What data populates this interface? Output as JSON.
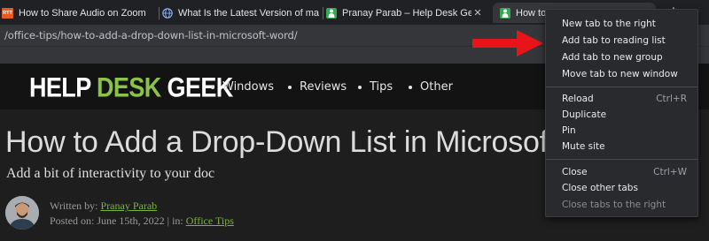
{
  "tabs": [
    {
      "title": "How to Share Audio on Zoom",
      "favicon": "rtt-favicon",
      "favicon_text": "RTT",
      "favicon_color": "#e85a1e",
      "active": false
    },
    {
      "title": "What Is the Latest Version of ma",
      "favicon": "globe-favicon",
      "favicon_color": "#1a73e8",
      "active": false
    },
    {
      "title": "Pranay Parab – Help Desk Geek",
      "favicon": "hdg-favicon",
      "favicon_color": "#34a853",
      "active": false
    },
    {
      "title": "How to Add a Drop-Down List in",
      "favicon": "hdg-favicon",
      "favicon_color": "#34a853",
      "active": true
    }
  ],
  "new_tab_symbol": "+",
  "address_bar": {
    "url": "/office-tips/how-to-add-a-drop-down-list-in-microsoft-word/"
  },
  "site": {
    "logo": {
      "part1": "HELP ",
      "accent": "DESK",
      "part2": " GEEK",
      "accent_color": "#8bc34a"
    },
    "nav": [
      {
        "label": "Windows"
      },
      {
        "label": "Reviews"
      },
      {
        "label": "Tips"
      },
      {
        "label": "Other"
      }
    ]
  },
  "article": {
    "title": "How to Add a Drop-Down List in Microsoft W",
    "subtitle": "Add a bit of interactivity to your doc",
    "author_prefix": "Written by:",
    "author": "Pranay Parab",
    "posted_prefix": "Posted on: June 15th, 2022 | in:",
    "category": "Office Tips"
  },
  "context_menu": {
    "groups": [
      [
        {
          "label": "New tab to the right",
          "shortcut": ""
        },
        {
          "label": "Add tab to reading list",
          "shortcut": ""
        },
        {
          "label": "Add tab to new group",
          "shortcut": ""
        },
        {
          "label": "Move tab to new window",
          "shortcut": ""
        }
      ],
      [
        {
          "label": "Reload",
          "shortcut": "Ctrl+R"
        },
        {
          "label": "Duplicate",
          "shortcut": ""
        },
        {
          "label": "Pin",
          "shortcut": ""
        },
        {
          "label": "Mute site",
          "shortcut": ""
        }
      ],
      [
        {
          "label": "Close",
          "shortcut": "Ctrl+W"
        },
        {
          "label": "Close other tabs",
          "shortcut": ""
        },
        {
          "label": "Close tabs to the right",
          "shortcut": "",
          "disabled": true
        }
      ]
    ]
  },
  "annotation": {
    "color": "#e8141a",
    "points_to": "Add tab to reading list"
  }
}
